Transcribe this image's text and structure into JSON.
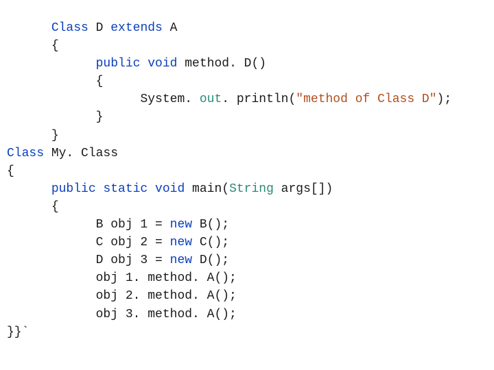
{
  "code": {
    "l1_a": "Class",
    "l1_b": " D ",
    "l1_c": "extends",
    "l1_d": " A",
    "l2": "{",
    "l3_a": "public void",
    "l3_b": " method. D()",
    "l4": "{",
    "l5_a": "System. ",
    "l5_b": "out",
    "l5_c": ". println(",
    "l5_d": "\"method of Class D\"",
    "l5_e": ");",
    "l6": "}",
    "l7": "}",
    "l8_a": "Class",
    "l8_b": " My. Class",
    "l9": "{",
    "l10_a": "public static void",
    "l10_b": " main(",
    "l10_c": "String",
    "l10_d": " args[])",
    "l11": "{",
    "l12_a": "B obj 1 = ",
    "l12_b": "new",
    "l12_c": " B();",
    "l13_a": "C obj 2 = ",
    "l13_b": "new",
    "l13_c": " C();",
    "l14_a": "D obj 3 = ",
    "l14_b": "new",
    "l14_c": " D();",
    "l15": "obj 1. method. A();",
    "l16": "obj 2. method. A();",
    "l17": "obj 3. method. A();",
    "l18": "}}`"
  }
}
